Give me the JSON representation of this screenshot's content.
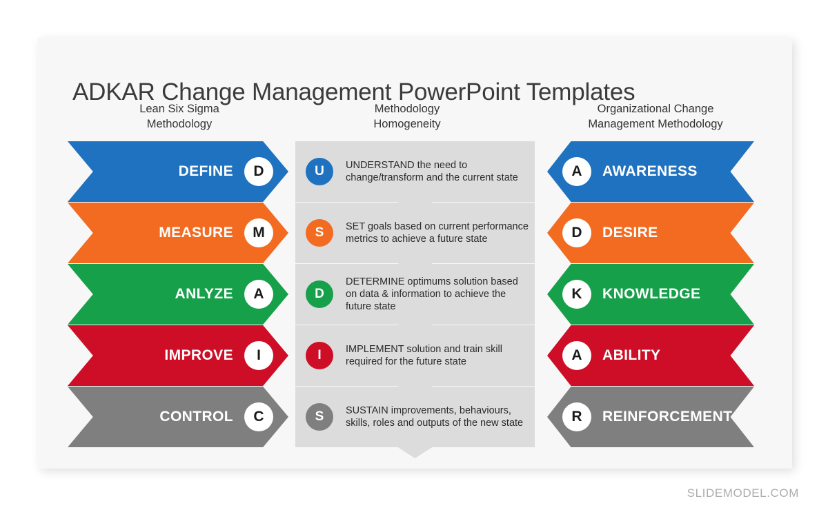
{
  "slide": {
    "title": "ADKAR Change Management PowerPoint Templates",
    "footer_brand": "SLIDEMODEL.COM",
    "panel_background": "#f7f7f7",
    "page_background": "#ffffff"
  },
  "columns": {
    "left_header_line1": "Lean Six Sigma",
    "left_header_line2": "Methodology",
    "center_header_line1": "Methodology",
    "center_header_line2": "Homogeneity",
    "right_header_line1": "Organizational Change",
    "right_header_line2": "Management Methodology"
  },
  "palette": {
    "blue": "#1f72bf",
    "orange": "#f26b21",
    "green": "#17a04a",
    "red": "#ce0e26",
    "gray": "#7f7f7f",
    "card_gray": "#dcdcdc",
    "badge_white": "#ffffff",
    "badge_letter": "#1a1a1a"
  },
  "left_column": [
    {
      "label": "DEFINE",
      "badge": "D",
      "color": "#1f72bf"
    },
    {
      "label": "MEASURE",
      "badge": "M",
      "color": "#f26b21"
    },
    {
      "label": "ANLYZE",
      "badge": "A",
      "color": "#17a04a"
    },
    {
      "label": "IMPROVE",
      "badge": "I",
      "color": "#ce0e26"
    },
    {
      "label": "CONTROL",
      "badge": "C",
      "color": "#7f7f7f"
    }
  ],
  "center_column": [
    {
      "badge": "U",
      "color": "#1f72bf",
      "text": "UNDERSTAND the need to change/transform and the current state"
    },
    {
      "badge": "S",
      "color": "#f26b21",
      "text": "SET goals based on current performance metrics to achieve a future state"
    },
    {
      "badge": "D",
      "color": "#17a04a",
      "text": "DETERMINE optimums solution based on data & information to achieve the future state"
    },
    {
      "badge": "I",
      "color": "#ce0e26",
      "text": "IMPLEMENT solution and train skill required for the future state"
    },
    {
      "badge": "S",
      "color": "#7f7f7f",
      "text": "SUSTAIN improvements, behaviours, skills, roles and outputs of the new state"
    }
  ],
  "right_column": [
    {
      "label": "AWARENESS",
      "badge": "A",
      "color": "#1f72bf"
    },
    {
      "label": "DESIRE",
      "badge": "D",
      "color": "#f26b21"
    },
    {
      "label": "KNOWLEDGE",
      "badge": "K",
      "color": "#17a04a"
    },
    {
      "label": "ABILITY",
      "badge": "A",
      "color": "#ce0e26"
    },
    {
      "label": "REINFORCEMENT",
      "badge": "R",
      "color": "#7f7f7f"
    }
  ]
}
